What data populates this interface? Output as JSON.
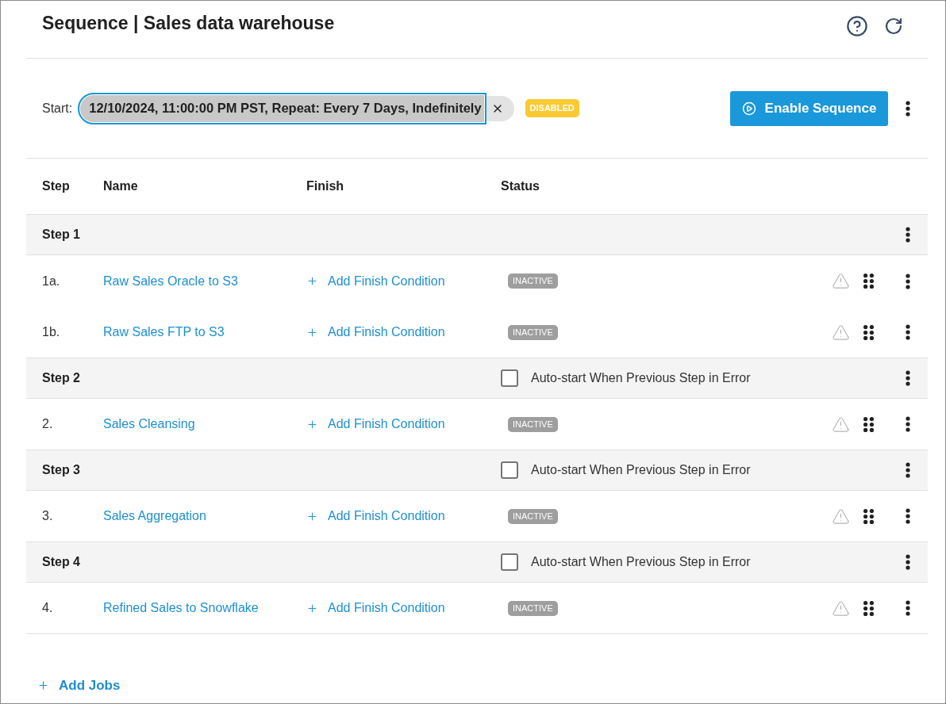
{
  "title": "Sequence | Sales data warehouse",
  "schedule": {
    "label": "Start:",
    "value": "12/10/2024, 11:00:00 PM PST, Repeat: Every 7 Days, Indefinitely",
    "focused": true,
    "status": "DISABLED"
  },
  "primary_action": {
    "label": "Enable Sequence"
  },
  "table": {
    "columns": [
      "Step",
      "Name",
      "Finish",
      "Status"
    ],
    "steps": [
      {
        "label": "Step 1",
        "jobs": [
          {
            "step": "1a.",
            "name": "Raw Sales Oracle to S3",
            "finish": "Add Finish Condition",
            "status": "INACTIVE"
          },
          {
            "step": "1b.",
            "name": "Raw Sales FTP to S3",
            "finish": "Add Finish Condition",
            "status": "INACTIVE"
          }
        ]
      },
      {
        "label": "Step 2",
        "auto_start": {
          "label": "Auto-start When Previous Step in Error",
          "checked": false
        },
        "jobs": [
          {
            "step": "2.",
            "name": "Sales Cleansing",
            "finish": "Add Finish Condition",
            "status": "INACTIVE"
          }
        ]
      },
      {
        "label": "Step 3",
        "auto_start": {
          "label": "Auto-start When Previous Step in Error",
          "checked": false
        },
        "jobs": [
          {
            "step": "3.",
            "name": "Sales Aggregation",
            "finish": "Add Finish Condition",
            "status": "INACTIVE"
          }
        ]
      },
      {
        "label": "Step 4",
        "auto_start": {
          "label": "Auto-start When Previous Step in Error",
          "checked": false
        },
        "jobs": [
          {
            "step": "4.",
            "name": "Refined Sales to Snowflake",
            "finish": "Add Finish Condition",
            "status": "INACTIVE"
          }
        ]
      }
    ]
  },
  "add_jobs": {
    "label": "Add Jobs"
  }
}
